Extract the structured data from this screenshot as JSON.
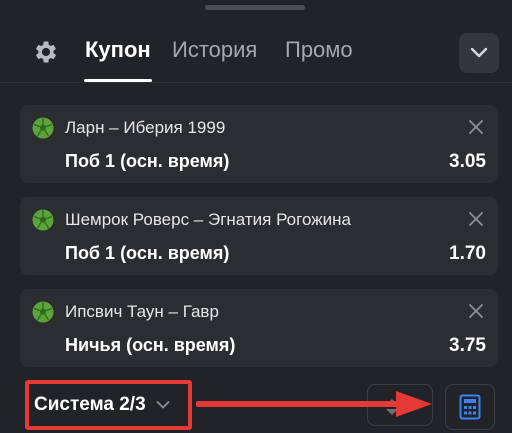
{
  "header": {
    "tabs": [
      {
        "label": "Купон",
        "active": true
      },
      {
        "label": "История",
        "active": false
      },
      {
        "label": "Промо",
        "active": false
      }
    ]
  },
  "bets": [
    {
      "match": "Ларн – Иберия 1999",
      "outcome": "Поб 1 (осн. время)",
      "odds": "3.05"
    },
    {
      "match": "Шемрок Роверс – Эгнатия Рогожина",
      "outcome": "Поб 1 (осн. время)",
      "odds": "1.70"
    },
    {
      "match": "Ипсвич Таун – Гавр",
      "outcome": "Ничья (осн. время)",
      "odds": "3.75"
    }
  ],
  "footer": {
    "system_label": "Система 2/3"
  },
  "colors": {
    "background": "#222326",
    "card": "#2c2d31",
    "highlight": "#e53935",
    "ball": "#5aa43a",
    "calculator_icon": "#3b82f6"
  },
  "icons": {
    "settings": "gear-icon",
    "collapse": "chevron-down-icon",
    "sport": "football-ball-icon",
    "remove": "close-icon",
    "sort": "sort-icon",
    "calculator": "calculator-icon"
  }
}
